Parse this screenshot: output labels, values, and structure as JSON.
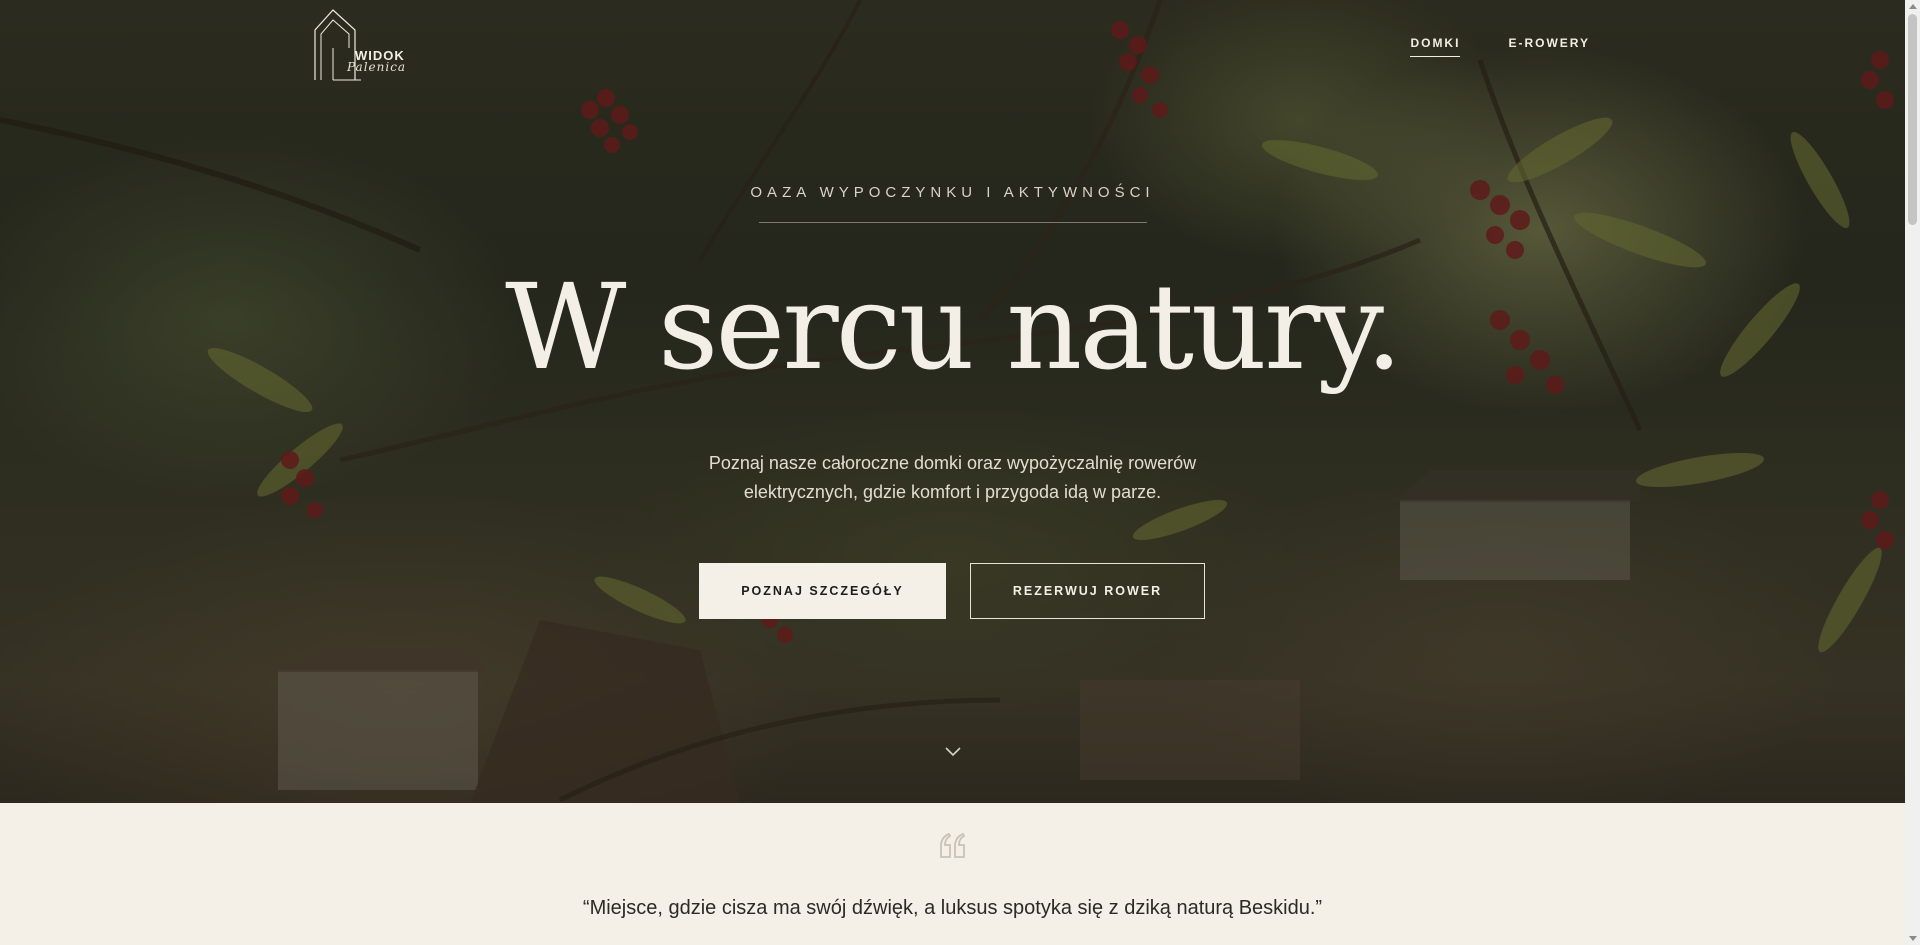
{
  "header": {
    "logo_word": "WIDOK",
    "logo_script": "Palenica",
    "nav": [
      {
        "label": "DOMKI",
        "active": true
      },
      {
        "label": "E-ROWERY",
        "active": false
      }
    ]
  },
  "hero": {
    "eyebrow": "OAZA WYPOCZYNKU I AKTYWNOŚCI",
    "headline": "W sercu natury.",
    "lead_line1": "Poznaj nasze całoroczne domki oraz wypożyczalnię rowerów",
    "lead_line2": "elektrycznych, gdzie komfort i przygoda idą w parze.",
    "btn_primary": "POZNAJ SZCZEGÓŁY",
    "btn_outline": "REZERWUJ ROWER",
    "scroll_icon": "chevron-down-icon"
  },
  "quote": {
    "icon": "quote-icon",
    "text": "“Miejsce, gdzie cisza ma swój dźwięk, a luksus spotyka się z dziką naturą Beskidu.”"
  },
  "colors": {
    "cream": "#f4f0e8",
    "dark_text": "#1e1d18",
    "light_text": "#f4efe6"
  }
}
